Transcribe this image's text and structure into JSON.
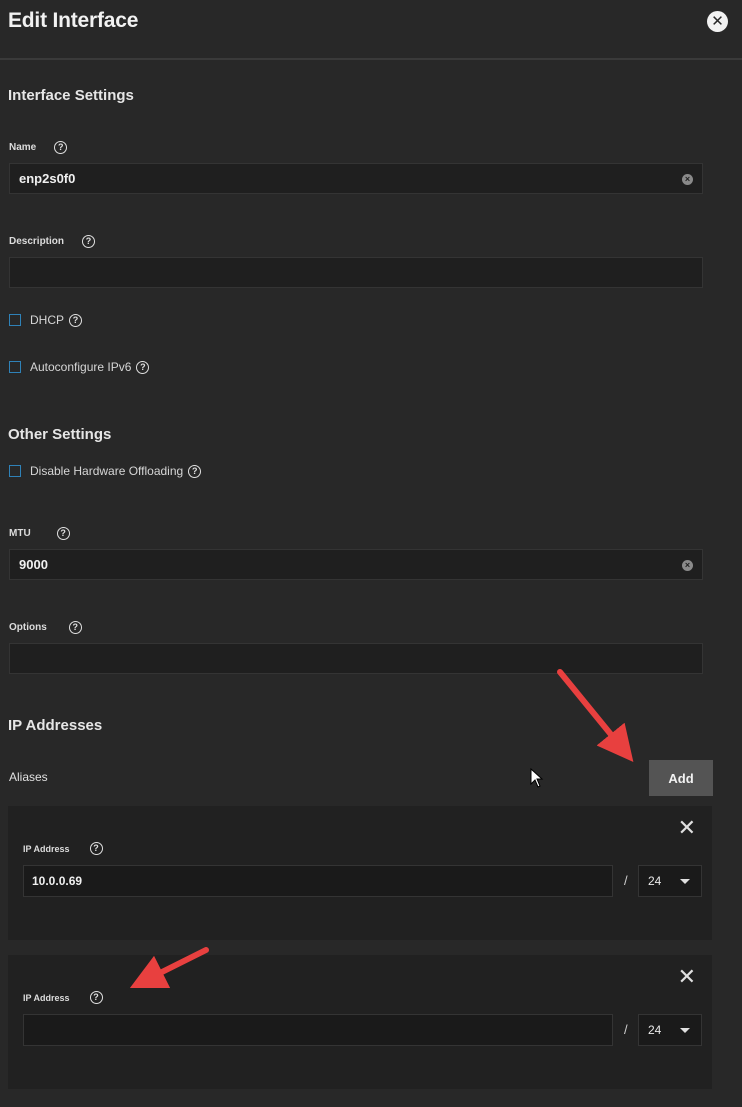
{
  "header": {
    "title": "Edit Interface",
    "close_icon": "close-circle-icon"
  },
  "interface_settings": {
    "heading": "Interface Settings",
    "name": {
      "label": "Name",
      "value": "enp2s0f0"
    },
    "description": {
      "label": "Description",
      "value": ""
    },
    "dhcp": {
      "label": "DHCP",
      "checked": false
    },
    "autoconfigure_ipv6": {
      "label": "Autoconfigure IPv6",
      "checked": false
    }
  },
  "other_settings": {
    "heading": "Other Settings",
    "disable_hw_offloading": {
      "label": "Disable Hardware Offloading",
      "checked": false
    },
    "mtu": {
      "label": "MTU",
      "value": "9000"
    },
    "options": {
      "label": "Options",
      "value": ""
    }
  },
  "ip_addresses": {
    "heading": "IP Addresses",
    "aliases_label": "Aliases",
    "add_label": "Add",
    "aliases": [
      {
        "label": "IP Address",
        "value": "10.0.0.69",
        "slash": "/",
        "netmask": "24"
      },
      {
        "label": "IP Address",
        "value": "",
        "slash": "/",
        "netmask": "24"
      }
    ]
  },
  "icons": {
    "help": "?",
    "clear": "×",
    "remove": "✕"
  },
  "colors": {
    "background": "#282828",
    "field": "#1f1f1f",
    "checkbox_border": "#2f82b8",
    "annotation_arrow": "#e8403f",
    "add_button": "#545454"
  }
}
